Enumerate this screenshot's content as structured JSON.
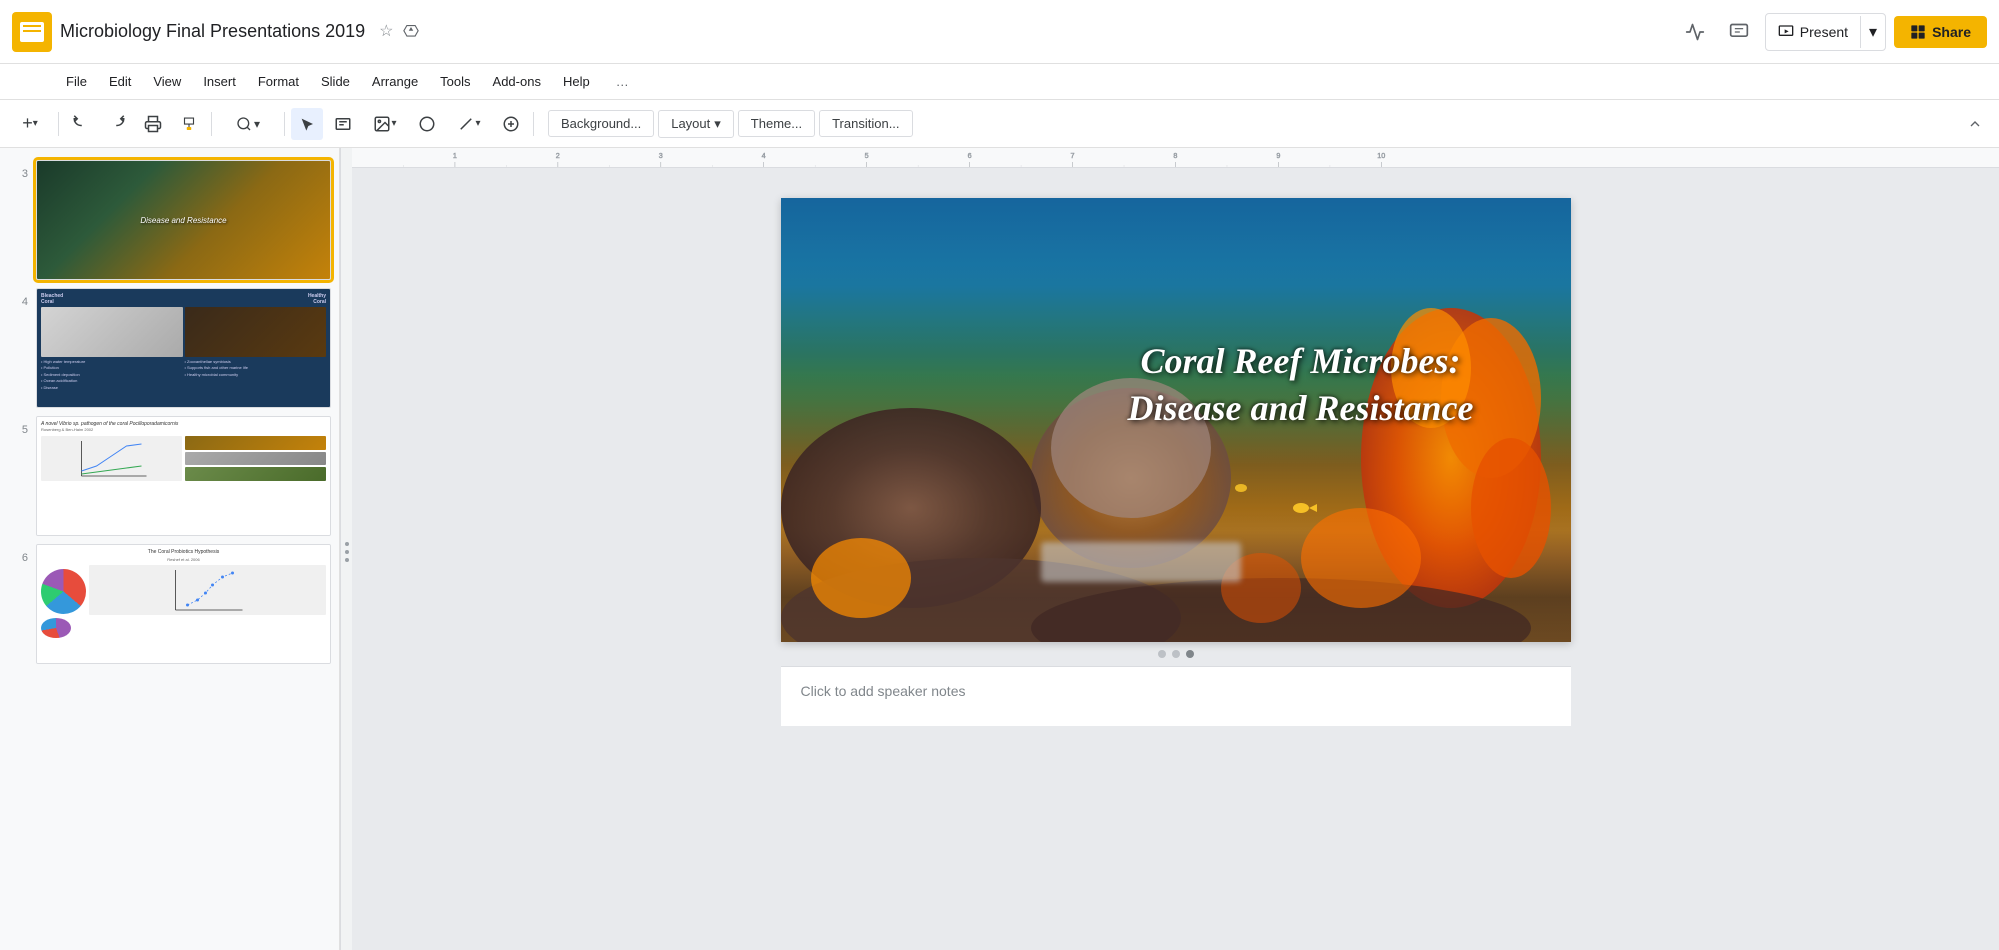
{
  "header": {
    "app_icon_alt": "Google Slides icon",
    "doc_title": "Microbiology Final Presentations 2019",
    "star_icon": "☆",
    "drive_icon": "▲",
    "activity_icon": "📈",
    "comments_icon": "💬",
    "present_icon": "▶",
    "present_label": "Present",
    "present_arrow": "▾",
    "share_icon": "⊞",
    "share_label": "Share"
  },
  "menu": {
    "items": [
      {
        "label": "File",
        "id": "file"
      },
      {
        "label": "Edit",
        "id": "edit"
      },
      {
        "label": "View",
        "id": "view"
      },
      {
        "label": "Insert",
        "id": "insert"
      },
      {
        "label": "Format",
        "id": "format"
      },
      {
        "label": "Slide",
        "id": "slide"
      },
      {
        "label": "Arrange",
        "id": "arrange"
      },
      {
        "label": "Tools",
        "id": "tools"
      },
      {
        "label": "Add-ons",
        "id": "addons"
      },
      {
        "label": "Help",
        "id": "help"
      },
      {
        "label": "…",
        "id": "more"
      }
    ]
  },
  "toolbar": {
    "add_icon": "+",
    "add_arrow": "▾",
    "undo_icon": "↩",
    "redo_icon": "↪",
    "print_icon": "🖨",
    "format_paint_icon": "🖌",
    "zoom_label": "🔍",
    "zoom_arrow": "▾",
    "cursor_icon": "↖",
    "text_box_icon": "T",
    "image_icon": "🖼",
    "image_arrow": "▾",
    "shape_icon": "○",
    "line_icon": "/",
    "line_arrow": "▾",
    "insert_plus": "+",
    "background_label": "Background...",
    "layout_label": "Layout",
    "layout_arrow": "▾",
    "theme_label": "Theme...",
    "transition_label": "Transition...",
    "collapse_icon": "⌃"
  },
  "slides": {
    "panel": [
      {
        "num": "3",
        "selected": false,
        "title": "Disease and Resistance",
        "type": "coral_dark"
      },
      {
        "num": "4",
        "selected": false,
        "title": "Bleached Coral vs Healthy Coral",
        "type": "comparison",
        "left_label": "Bleached Coral",
        "right_label": "Healthy Coral",
        "left_bullets": [
          "High water temperature",
          "Pollution",
          "Sediment deposition",
          "Ocean acidification",
          "Disease"
        ],
        "right_bullets": [
          "Zooxanthellae symbiosis",
          "Supports fish and other marine life",
          "Healthy microbial community"
        ]
      },
      {
        "num": "5",
        "selected": false,
        "title": "A novel Vibrio sp. pathogen of the coral Pocilloporadamicornis",
        "subtitle": "Rosenberg & Ben-Haim 2002",
        "type": "research"
      },
      {
        "num": "6",
        "selected": false,
        "title": "The Coral Probiotics Hypothesis",
        "subtitle": "Reshef et al. 2006",
        "type": "probiotics"
      }
    ],
    "current": {
      "title_line1": "Coral Reef Microbes:",
      "title_line2": "Disease and Resistance",
      "dots": [
        false,
        false,
        true
      ]
    }
  },
  "notes": {
    "placeholder": "Click to add speaker notes"
  },
  "colors": {
    "accent_yellow": "#f4b400",
    "brand_blue": "#4285f4",
    "text_dark": "#202124",
    "text_medium": "#5f6368",
    "text_light": "#80868b",
    "border": "#dadce0"
  }
}
